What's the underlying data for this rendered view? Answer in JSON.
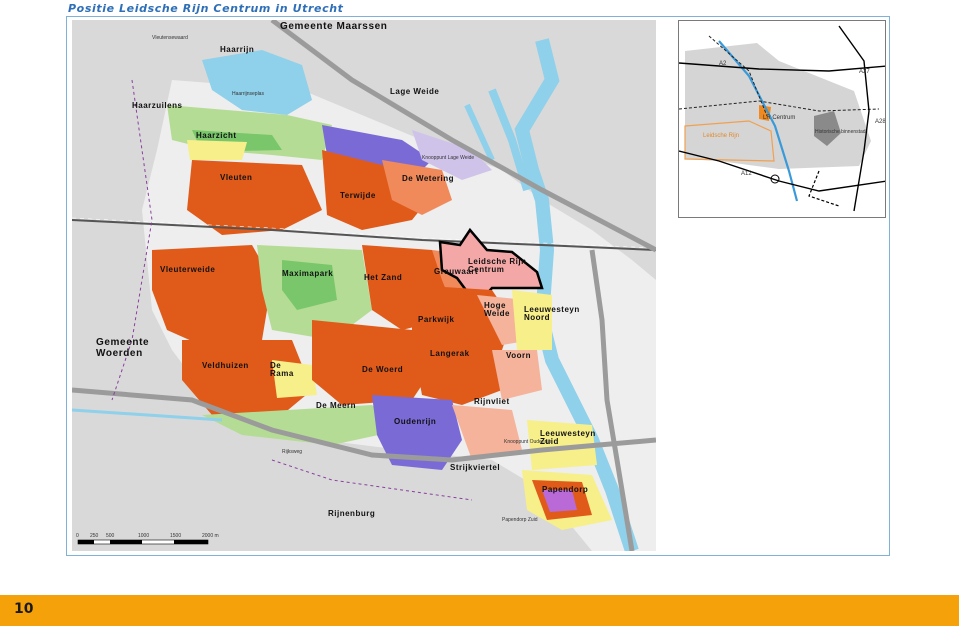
{
  "title": "Positie Leidsche Rijn Centrum in Utrecht",
  "page_number": "10",
  "colors": {
    "title": "#2e6fb7",
    "frame": "#7fb2d9",
    "footer": "#f5a20a",
    "water": "#8fd0ea",
    "residential": "#e05a1a",
    "business": "#7a6ad6",
    "green": "#b5dc95",
    "park": "#79c76a",
    "yellow": "#f7ef8a",
    "highlight_outline": "#000000"
  },
  "map": {
    "districts": [
      "Gemeente Maarssen",
      "Haarrijn",
      "Haarzuilens",
      "Lage Weide",
      "Haarzicht",
      "Vleuten",
      "Terwijde",
      "De Wetering",
      "Vleuterweide",
      "Maximapark",
      "Het Zand",
      "Grauwaart",
      "Leidsche Rijn Centrum",
      "Hoge Weide",
      "Parkwijk",
      "Leeuwesteyn Noord",
      "Gemeente Woerden",
      "Veldhuizen",
      "De Rama",
      "Langerak",
      "Voorn",
      "De Woerd",
      "De Meern",
      "Rijnvliet",
      "Oudenrijn",
      "Leeuwesteyn Zuid",
      "Strijkviertel",
      "Papendorp",
      "Rijnenburg"
    ],
    "streets": [
      "Vleutensewaard",
      "Haarrijnseplas",
      "Knooppunt Lage Weide",
      "Knooppunt Oudenrijn",
      "Papendorp Zuid",
      "Rijksweg"
    ],
    "scale_ticks": [
      "0",
      "250",
      "500",
      "1000",
      "1500",
      "2000 m"
    ]
  },
  "inset": {
    "highways": [
      "A2",
      "A27",
      "A28",
      "A12"
    ],
    "labels": [
      "LR Centrum",
      "Leidsche Rijn",
      "Historische binnenstad"
    ]
  }
}
